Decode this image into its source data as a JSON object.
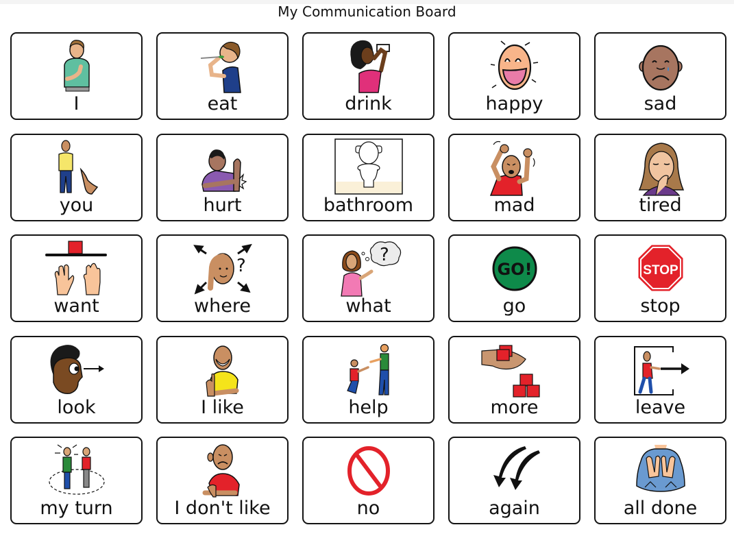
{
  "title": "My Communication Board",
  "cells": [
    {
      "label": "I",
      "icon": "person-pointing-self-icon"
    },
    {
      "label": "eat",
      "icon": "person-eating-icon"
    },
    {
      "label": "drink",
      "icon": "person-drinking-icon"
    },
    {
      "label": "happy",
      "icon": "happy-face-icon"
    },
    {
      "label": "sad",
      "icon": "sad-face-icon"
    },
    {
      "label": "you",
      "icon": "pointing-at-person-icon"
    },
    {
      "label": "hurt",
      "icon": "hurt-arm-icon"
    },
    {
      "label": "bathroom",
      "icon": "toilet-icon"
    },
    {
      "label": "mad",
      "icon": "angry-person-icon"
    },
    {
      "label": "tired",
      "icon": "yawning-person-icon"
    },
    {
      "label": "want",
      "icon": "hands-reaching-icon"
    },
    {
      "label": "where",
      "icon": "searching-person-icon"
    },
    {
      "label": "what",
      "icon": "thinking-question-icon"
    },
    {
      "label": "go",
      "icon": "go-sign-icon",
      "sign_text": "GO!"
    },
    {
      "label": "stop",
      "icon": "stop-sign-icon",
      "sign_text": "STOP"
    },
    {
      "label": "look",
      "icon": "eye-look-icon"
    },
    {
      "label": "I like",
      "icon": "thumbs-up-person-icon"
    },
    {
      "label": "help",
      "icon": "helping-people-icon"
    },
    {
      "label": "more",
      "icon": "blocks-in-hand-icon"
    },
    {
      "label": "leave",
      "icon": "person-leaving-icon"
    },
    {
      "label": "my turn",
      "icon": "taking-turns-icon"
    },
    {
      "label": "I don't like",
      "icon": "thumbs-down-person-icon"
    },
    {
      "label": "no",
      "icon": "prohibited-icon"
    },
    {
      "label": "again",
      "icon": "repeat-arrows-icon"
    },
    {
      "label": "all done",
      "icon": "finished-sign-icon"
    }
  ],
  "colors": {
    "card_border": "#141414",
    "go_green": "#0e8a4a",
    "stop_red": "#e3222a",
    "block_red": "#e3222a",
    "skin_light": "#f4b183",
    "skin_medium": "#c98f62",
    "skin_dark": "#7a4a22"
  }
}
